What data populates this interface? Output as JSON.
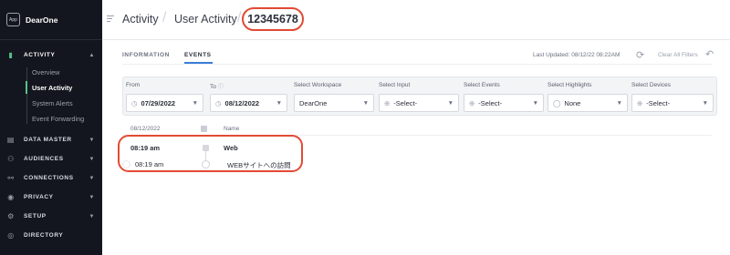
{
  "app": {
    "logo_text": "App",
    "name": "DearOne"
  },
  "sidebar": {
    "sections": [
      {
        "label": "ACTIVITY",
        "icon": "activity-icon"
      },
      {
        "label": "DATA MASTER",
        "icon": "database-icon"
      },
      {
        "label": "AUDIENCES",
        "icon": "people-icon"
      },
      {
        "label": "CONNECTIONS",
        "icon": "connections-icon"
      },
      {
        "label": "PRIVACY",
        "icon": "privacy-icon"
      },
      {
        "label": "SETUP",
        "icon": "gear-icon"
      },
      {
        "label": "DIRECTORY",
        "icon": "globe-icon"
      }
    ],
    "activity_items": [
      {
        "label": "Overview"
      },
      {
        "label": "User Activity"
      },
      {
        "label": "System Alerts"
      },
      {
        "label": "Event Forwarding"
      }
    ]
  },
  "breadcrumb": {
    "items": [
      "Activity",
      "User Activity"
    ],
    "id": "12345678"
  },
  "tabs": [
    {
      "label": "INFORMATION"
    },
    {
      "label": "EVENTS"
    }
  ],
  "status": {
    "last_updated": "Last Updated: 08/12/22 08:22AM",
    "clear_filters": "Clear All Filters"
  },
  "filters": {
    "from": {
      "label": "From",
      "value": "07/29/2022"
    },
    "to": {
      "label": "To",
      "value": "08/12/2022"
    },
    "workspace": {
      "label": "Select Workspace",
      "value": "DearOne"
    },
    "input": {
      "label": "Select Input",
      "value": "-Select-"
    },
    "events": {
      "label": "Select Events",
      "value": "-Select-"
    },
    "highlights": {
      "label": "Select Highlights",
      "value": "None"
    },
    "devices": {
      "label": "Select Devices",
      "value": "-Select-"
    }
  },
  "table": {
    "date_header": "08/12/2022",
    "name_header": "Name",
    "group_time": "08:19 am",
    "group_name": "Web",
    "event_time": "08:19 am",
    "event_name": "WEBサイトへの訪問"
  },
  "colors": {
    "accent_green": "#56c08b",
    "accent_blue": "#3b7dd8",
    "highlight_red": "#e24a35",
    "sidebar_bg": "#14161f"
  }
}
